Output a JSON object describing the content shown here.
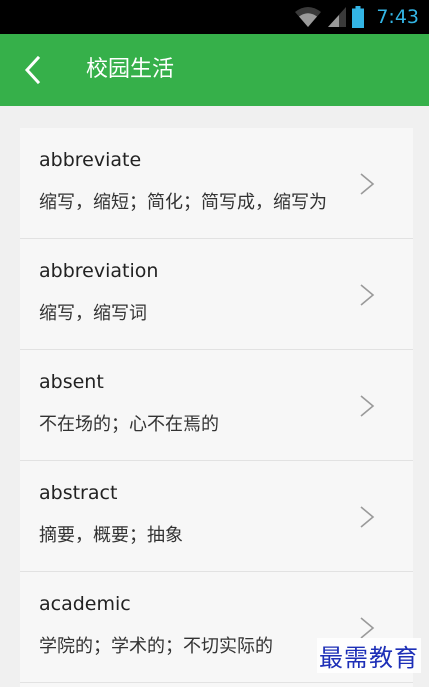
{
  "status_bar": {
    "time": "7:43",
    "icons": [
      "wifi-icon",
      "signal-icon",
      "battery-icon"
    ],
    "time_color": "#33b5e5"
  },
  "app_bar": {
    "title": "校园生活",
    "back_icon": "chevron-left-icon",
    "background": "#36b04a"
  },
  "words": [
    {
      "word": "abbreviate",
      "meaning": "缩写，缩短；简化；简写成，缩写为"
    },
    {
      "word": "abbreviation",
      "meaning": "缩写，缩写词"
    },
    {
      "word": "absent",
      "meaning": "不在场的；心不在焉的"
    },
    {
      "word": "abstract",
      "meaning": "摘要，概要；抽象"
    },
    {
      "word": "academic",
      "meaning": "学院的；学术的；不切实际的"
    }
  ],
  "watermark": "最需教育"
}
